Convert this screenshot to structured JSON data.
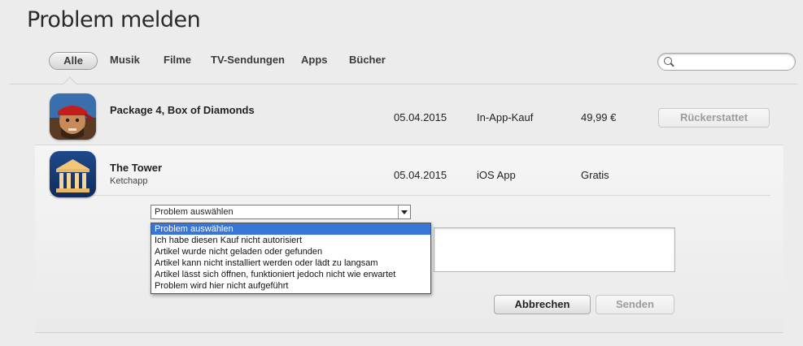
{
  "page": {
    "title": "Problem melden"
  },
  "tabs": [
    {
      "label": "Alle",
      "active": true
    },
    {
      "label": "Musik"
    },
    {
      "label": "Filme"
    },
    {
      "label": "TV-Sendungen"
    },
    {
      "label": "Apps"
    },
    {
      "label": "Bücher"
    }
  ],
  "search": {
    "placeholder": "",
    "value": ""
  },
  "items": [
    {
      "title": "Package 4, Box of Diamonds",
      "subtitle": "",
      "date": "05.04.2015",
      "type": "In-App-Kauf",
      "price": "49,99 €",
      "action_label": "Rückerstattet",
      "icon": "game-warrior-icon"
    },
    {
      "title": "The Tower",
      "subtitle": "Ketchapp",
      "date": "05.04.2015",
      "type": "iOS App",
      "price": "Gratis",
      "icon": "tower-temple-icon"
    }
  ],
  "report": {
    "selected": "Problem auswählen",
    "options": [
      "Problem auswählen",
      "Ich habe diesen Kauf nicht autorisiert",
      "Artikel wurde nicht geladen oder gefunden",
      "Artikel kann nicht installiert werden oder lädt zu langsam",
      "Artikel lässt sich öffnen, funktioniert jedoch nicht wie erwartet",
      "Problem wird hier nicht aufgeführt"
    ],
    "cancel_label": "Abbrechen",
    "send_label": "Senden"
  },
  "colors": {
    "highlight": "#3875d7",
    "background": "#ececec"
  }
}
